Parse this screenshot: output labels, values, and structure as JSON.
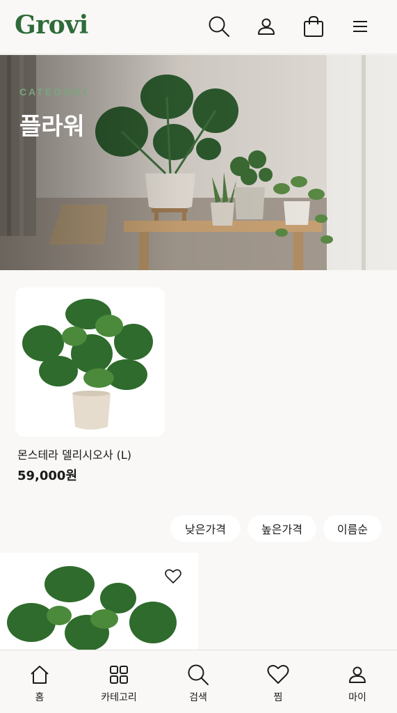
{
  "header": {
    "logo": "Grovi",
    "icons": [
      "search-icon",
      "user-icon",
      "shopping-bag-icon",
      "menu-icon"
    ]
  },
  "hero": {
    "category_label": "CATEGORY",
    "title": "플라워"
  },
  "products": [
    {
      "name": "몬스테라 델리시오사 (L)",
      "price": "59,000원"
    }
  ],
  "sort": {
    "options": [
      "낮은가격",
      "높은가격",
      "이름순"
    ]
  },
  "bottom_nav": {
    "items": [
      {
        "label": "홈",
        "icon": "home-icon"
      },
      {
        "label": "카테고리",
        "icon": "grid-icon"
      },
      {
        "label": "검색",
        "icon": "search-icon"
      },
      {
        "label": "찜",
        "icon": "heart-icon"
      },
      {
        "label": "마이",
        "icon": "user-icon"
      }
    ]
  },
  "colors": {
    "brand_green": "#2f6b3a",
    "background": "#f9f8f6",
    "category_green": "#7aa57f"
  }
}
